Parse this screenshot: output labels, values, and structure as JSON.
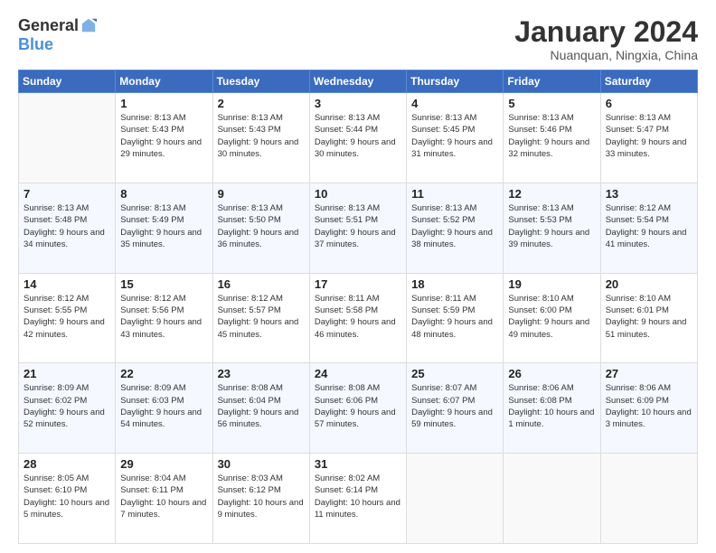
{
  "logo": {
    "general": "General",
    "blue": "Blue"
  },
  "title": "January 2024",
  "location": "Nuanquan, Ningxia, China",
  "days_header": [
    "Sunday",
    "Monday",
    "Tuesday",
    "Wednesday",
    "Thursday",
    "Friday",
    "Saturday"
  ],
  "weeks": [
    [
      {
        "day": "",
        "sunrise": "",
        "sunset": "",
        "daylight": ""
      },
      {
        "day": "1",
        "sunrise": "Sunrise: 8:13 AM",
        "sunset": "Sunset: 5:43 PM",
        "daylight": "Daylight: 9 hours and 29 minutes."
      },
      {
        "day": "2",
        "sunrise": "Sunrise: 8:13 AM",
        "sunset": "Sunset: 5:43 PM",
        "daylight": "Daylight: 9 hours and 30 minutes."
      },
      {
        "day": "3",
        "sunrise": "Sunrise: 8:13 AM",
        "sunset": "Sunset: 5:44 PM",
        "daylight": "Daylight: 9 hours and 30 minutes."
      },
      {
        "day": "4",
        "sunrise": "Sunrise: 8:13 AM",
        "sunset": "Sunset: 5:45 PM",
        "daylight": "Daylight: 9 hours and 31 minutes."
      },
      {
        "day": "5",
        "sunrise": "Sunrise: 8:13 AM",
        "sunset": "Sunset: 5:46 PM",
        "daylight": "Daylight: 9 hours and 32 minutes."
      },
      {
        "day": "6",
        "sunrise": "Sunrise: 8:13 AM",
        "sunset": "Sunset: 5:47 PM",
        "daylight": "Daylight: 9 hours and 33 minutes."
      }
    ],
    [
      {
        "day": "7",
        "sunrise": "Sunrise: 8:13 AM",
        "sunset": "Sunset: 5:48 PM",
        "daylight": "Daylight: 9 hours and 34 minutes."
      },
      {
        "day": "8",
        "sunrise": "Sunrise: 8:13 AM",
        "sunset": "Sunset: 5:49 PM",
        "daylight": "Daylight: 9 hours and 35 minutes."
      },
      {
        "day": "9",
        "sunrise": "Sunrise: 8:13 AM",
        "sunset": "Sunset: 5:50 PM",
        "daylight": "Daylight: 9 hours and 36 minutes."
      },
      {
        "day": "10",
        "sunrise": "Sunrise: 8:13 AM",
        "sunset": "Sunset: 5:51 PM",
        "daylight": "Daylight: 9 hours and 37 minutes."
      },
      {
        "day": "11",
        "sunrise": "Sunrise: 8:13 AM",
        "sunset": "Sunset: 5:52 PM",
        "daylight": "Daylight: 9 hours and 38 minutes."
      },
      {
        "day": "12",
        "sunrise": "Sunrise: 8:13 AM",
        "sunset": "Sunset: 5:53 PM",
        "daylight": "Daylight: 9 hours and 39 minutes."
      },
      {
        "day": "13",
        "sunrise": "Sunrise: 8:12 AM",
        "sunset": "Sunset: 5:54 PM",
        "daylight": "Daylight: 9 hours and 41 minutes."
      }
    ],
    [
      {
        "day": "14",
        "sunrise": "Sunrise: 8:12 AM",
        "sunset": "Sunset: 5:55 PM",
        "daylight": "Daylight: 9 hours and 42 minutes."
      },
      {
        "day": "15",
        "sunrise": "Sunrise: 8:12 AM",
        "sunset": "Sunset: 5:56 PM",
        "daylight": "Daylight: 9 hours and 43 minutes."
      },
      {
        "day": "16",
        "sunrise": "Sunrise: 8:12 AM",
        "sunset": "Sunset: 5:57 PM",
        "daylight": "Daylight: 9 hours and 45 minutes."
      },
      {
        "day": "17",
        "sunrise": "Sunrise: 8:11 AM",
        "sunset": "Sunset: 5:58 PM",
        "daylight": "Daylight: 9 hours and 46 minutes."
      },
      {
        "day": "18",
        "sunrise": "Sunrise: 8:11 AM",
        "sunset": "Sunset: 5:59 PM",
        "daylight": "Daylight: 9 hours and 48 minutes."
      },
      {
        "day": "19",
        "sunrise": "Sunrise: 8:10 AM",
        "sunset": "Sunset: 6:00 PM",
        "daylight": "Daylight: 9 hours and 49 minutes."
      },
      {
        "day": "20",
        "sunrise": "Sunrise: 8:10 AM",
        "sunset": "Sunset: 6:01 PM",
        "daylight": "Daylight: 9 hours and 51 minutes."
      }
    ],
    [
      {
        "day": "21",
        "sunrise": "Sunrise: 8:09 AM",
        "sunset": "Sunset: 6:02 PM",
        "daylight": "Daylight: 9 hours and 52 minutes."
      },
      {
        "day": "22",
        "sunrise": "Sunrise: 8:09 AM",
        "sunset": "Sunset: 6:03 PM",
        "daylight": "Daylight: 9 hours and 54 minutes."
      },
      {
        "day": "23",
        "sunrise": "Sunrise: 8:08 AM",
        "sunset": "Sunset: 6:04 PM",
        "daylight": "Daylight: 9 hours and 56 minutes."
      },
      {
        "day": "24",
        "sunrise": "Sunrise: 8:08 AM",
        "sunset": "Sunset: 6:06 PM",
        "daylight": "Daylight: 9 hours and 57 minutes."
      },
      {
        "day": "25",
        "sunrise": "Sunrise: 8:07 AM",
        "sunset": "Sunset: 6:07 PM",
        "daylight": "Daylight: 9 hours and 59 minutes."
      },
      {
        "day": "26",
        "sunrise": "Sunrise: 8:06 AM",
        "sunset": "Sunset: 6:08 PM",
        "daylight": "Daylight: 10 hours and 1 minute."
      },
      {
        "day": "27",
        "sunrise": "Sunrise: 8:06 AM",
        "sunset": "Sunset: 6:09 PM",
        "daylight": "Daylight: 10 hours and 3 minutes."
      }
    ],
    [
      {
        "day": "28",
        "sunrise": "Sunrise: 8:05 AM",
        "sunset": "Sunset: 6:10 PM",
        "daylight": "Daylight: 10 hours and 5 minutes."
      },
      {
        "day": "29",
        "sunrise": "Sunrise: 8:04 AM",
        "sunset": "Sunset: 6:11 PM",
        "daylight": "Daylight: 10 hours and 7 minutes."
      },
      {
        "day": "30",
        "sunrise": "Sunrise: 8:03 AM",
        "sunset": "Sunset: 6:12 PM",
        "daylight": "Daylight: 10 hours and 9 minutes."
      },
      {
        "day": "31",
        "sunrise": "Sunrise: 8:02 AM",
        "sunset": "Sunset: 6:14 PM",
        "daylight": "Daylight: 10 hours and 11 minutes."
      },
      {
        "day": "",
        "sunrise": "",
        "sunset": "",
        "daylight": ""
      },
      {
        "day": "",
        "sunrise": "",
        "sunset": "",
        "daylight": ""
      },
      {
        "day": "",
        "sunrise": "",
        "sunset": "",
        "daylight": ""
      }
    ]
  ]
}
